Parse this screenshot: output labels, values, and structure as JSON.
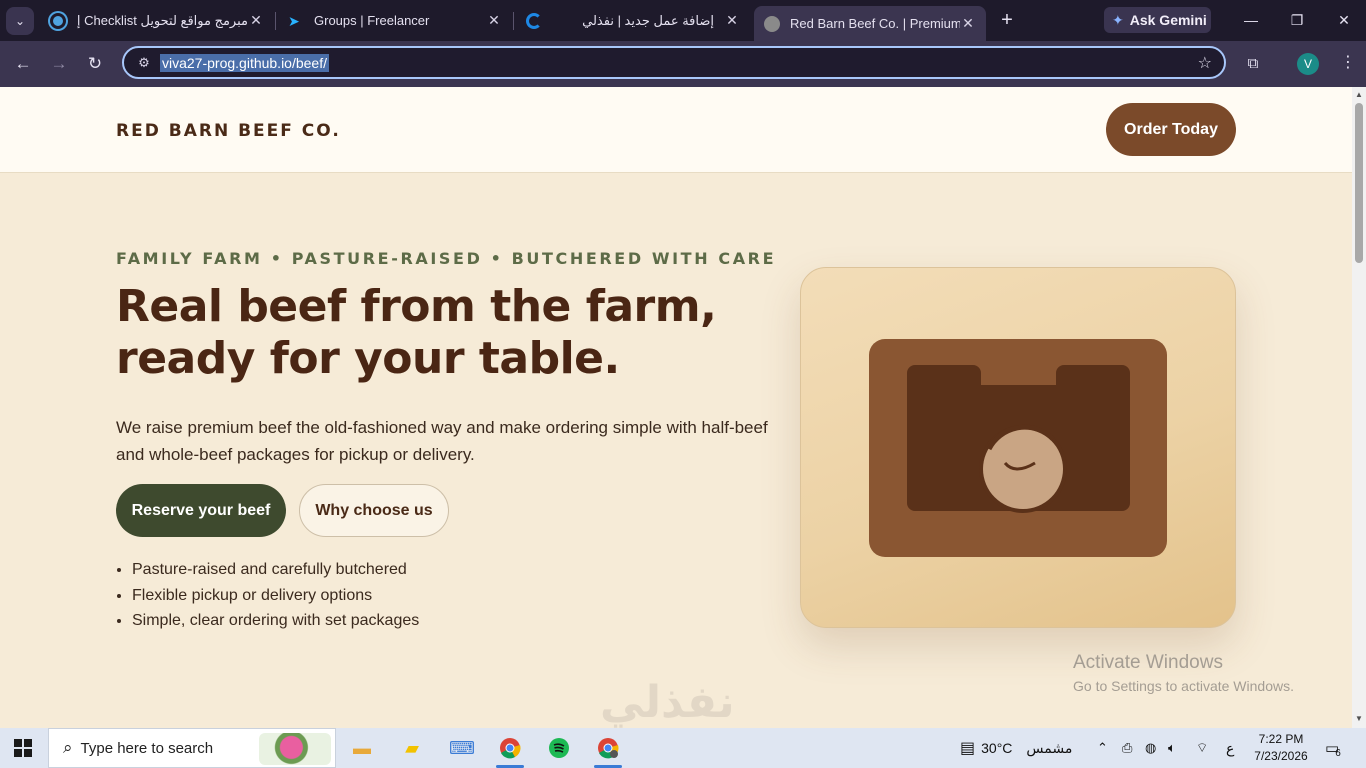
{
  "browser": {
    "tabs": [
      {
        "title": "مبرمج مواقع لتحويل Checklist إل",
        "favicon_color": "#4fa3e0"
      },
      {
        "title": "Groups | Freelancer",
        "favicon_color": "#29b2fe"
      },
      {
        "title": "إضافة عمل جديد | نفذلي",
        "favicon_color": "#1e88e5"
      },
      {
        "title": "Red Barn Beef Co. | Premium Fa",
        "favicon_color": "#8a8a8a"
      }
    ],
    "gemini_label": "Ask Gemini",
    "url": "viva27-prog.github.io/beef/",
    "profile_initial": "V"
  },
  "site": {
    "brand": "RED BARN BEEF CO.",
    "order_button": "Order Today",
    "hero": {
      "eyebrow": "FAMILY FARM • PASTURE-RAISED • BUTCHERED WITH CARE",
      "headline_line1": "Real beef from the farm,",
      "headline_line2": "ready for your table.",
      "lead": "We raise premium beef the old-fashioned way and make ordering simple with half-beef and whole-beef packages for pickup or delivery.",
      "primary_cta": "Reserve your beef",
      "secondary_cta": "Why choose us",
      "bullets": [
        "Pasture-raised and carefully butchered",
        "Flexible pickup or delivery options",
        "Simple, clear ordering with set packages"
      ]
    },
    "colors": {
      "brand_brown": "#7b4a2a",
      "olive": "#3e4a2e",
      "cream": "#f6ebd7"
    }
  },
  "overlay": {
    "activate_title": "Activate Windows",
    "activate_sub": "Go to Settings to activate Windows.",
    "watermark": "نفذلي"
  },
  "taskbar": {
    "search_placeholder": "Type here to search",
    "apps": [
      "file-explorer-icon",
      "sticky-notes-icon",
      "laptop-icon",
      "chrome-icon",
      "spotify-icon",
      "chrome-profile-icon"
    ],
    "weather_temp": "30°C",
    "weather_label": "مشمس",
    "lang": "ع",
    "time": "7:22 PM",
    "date": "7/23/2026",
    "notifications": "6"
  }
}
